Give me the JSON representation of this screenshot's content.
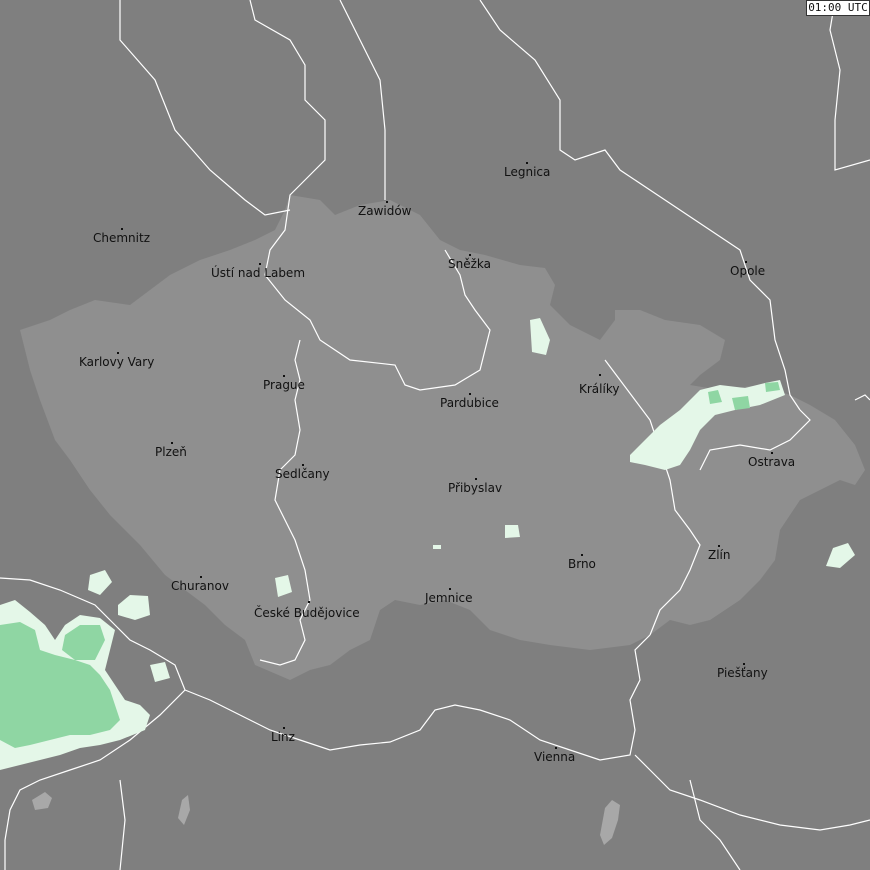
{
  "time_label": "01:00 UTC",
  "colors": {
    "background": "#7f7f7f",
    "country_fill": "#8f8f8f",
    "border": "#ffffff",
    "precip_light": "#e4f7e8",
    "precip_moderate": "#8fd6a3",
    "water": "#a8a8a8"
  },
  "cities": [
    {
      "id": "legnica",
      "name": "Legnica"
    },
    {
      "id": "zawidow",
      "name": "Zawidów"
    },
    {
      "id": "chemnitz",
      "name": "Chemnitz"
    },
    {
      "id": "usti",
      "name": "Ústí nad Labem"
    },
    {
      "id": "snezka",
      "name": "Sněžka"
    },
    {
      "id": "opole",
      "name": "Opole"
    },
    {
      "id": "karlovy-vary",
      "name": "Karlovy Vary"
    },
    {
      "id": "prague",
      "name": "Prague"
    },
    {
      "id": "kraliky",
      "name": "Králíky"
    },
    {
      "id": "pardubice",
      "name": "Pardubice"
    },
    {
      "id": "plzen",
      "name": "Plzeň"
    },
    {
      "id": "ostrava",
      "name": "Ostrava"
    },
    {
      "id": "sedlcany",
      "name": "Sedlčany"
    },
    {
      "id": "pribyslav",
      "name": "Přibyslav"
    },
    {
      "id": "zlin",
      "name": "Zlín"
    },
    {
      "id": "brno",
      "name": "Brno"
    },
    {
      "id": "churanov",
      "name": "Churanov"
    },
    {
      "id": "jemnice",
      "name": "Jemnice"
    },
    {
      "id": "ceske-budejovice",
      "name": "České Budějovice"
    },
    {
      "id": "piestany",
      "name": "Piešťany"
    },
    {
      "id": "linz",
      "name": "Linz"
    },
    {
      "id": "vienna",
      "name": "Vienna"
    }
  ]
}
